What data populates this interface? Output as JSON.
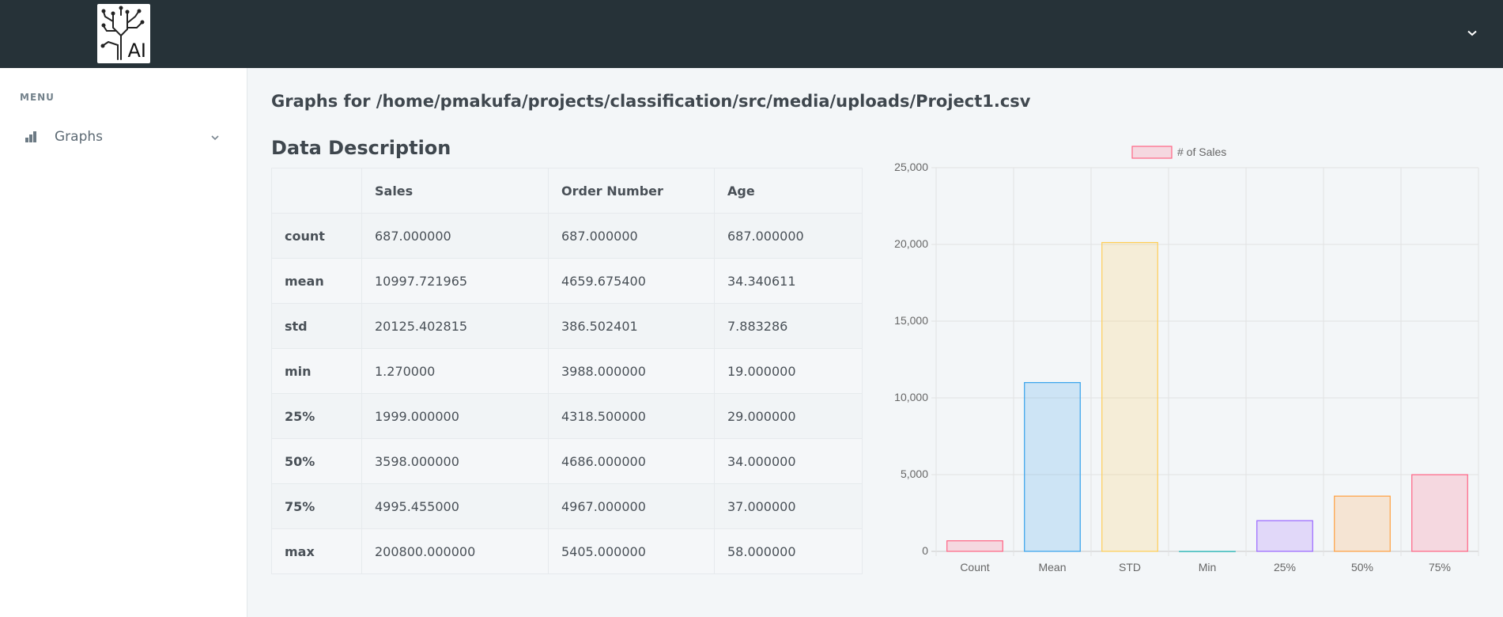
{
  "header": {
    "logo_text": "AI"
  },
  "sidebar": {
    "menu_title": "MENU",
    "items": [
      {
        "label": "Graphs"
      }
    ]
  },
  "page_title": "Graphs for /home/pmakufa/projects/classification/src/media/uploads/Project1.csv",
  "section_title": "Data Description",
  "table": {
    "columns": [
      "",
      "Sales",
      "Order Number",
      "Age"
    ],
    "rows": [
      {
        "label": "count",
        "values": [
          "687.000000",
          "687.000000",
          "687.000000"
        ]
      },
      {
        "label": "mean",
        "values": [
          "10997.721965",
          "4659.675400",
          "34.340611"
        ]
      },
      {
        "label": "std",
        "values": [
          "20125.402815",
          "386.502401",
          "7.883286"
        ]
      },
      {
        "label": "min",
        "values": [
          "1.270000",
          "3988.000000",
          "19.000000"
        ]
      },
      {
        "label": "25%",
        "values": [
          "1999.000000",
          "4318.500000",
          "29.000000"
        ]
      },
      {
        "label": "50%",
        "values": [
          "3598.000000",
          "4686.000000",
          "34.000000"
        ]
      },
      {
        "label": "75%",
        "values": [
          "4995.455000",
          "4967.000000",
          "37.000000"
        ]
      },
      {
        "label": "max",
        "values": [
          "200800.000000",
          "5405.000000",
          "58.000000"
        ]
      }
    ]
  },
  "chart_data": {
    "type": "bar",
    "categories": [
      "Count",
      "Mean",
      "STD",
      "Min",
      "25%",
      "50%",
      "75%"
    ],
    "series": [
      {
        "name": "# of Sales",
        "values": [
          687,
          10997.72,
          20125.4,
          1.27,
          1999,
          3598,
          4995.46
        ]
      }
    ],
    "ylim": [
      0,
      25000
    ],
    "yticks": [
      0,
      5000,
      10000,
      15000,
      20000,
      25000
    ],
    "ytick_labels": [
      "0",
      "5,000",
      "10,000",
      "15,000",
      "20,000",
      "25,000"
    ],
    "legend_position": "top",
    "grid": true,
    "colors": {
      "fill": [
        "rgba(255,99,132,0.2)",
        "rgba(54,162,235,0.2)",
        "rgba(255,206,86,0.2)",
        "rgba(75,192,192,0.2)",
        "rgba(153,102,255,0.2)",
        "rgba(255,159,64,0.2)",
        "rgba(255,99,132,0.2)"
      ],
      "stroke": [
        "#ff6384",
        "#36a2eb",
        "#ffce56",
        "#4bc0c0",
        "#9966ff",
        "#ff9f40",
        "#ff6384"
      ]
    }
  }
}
